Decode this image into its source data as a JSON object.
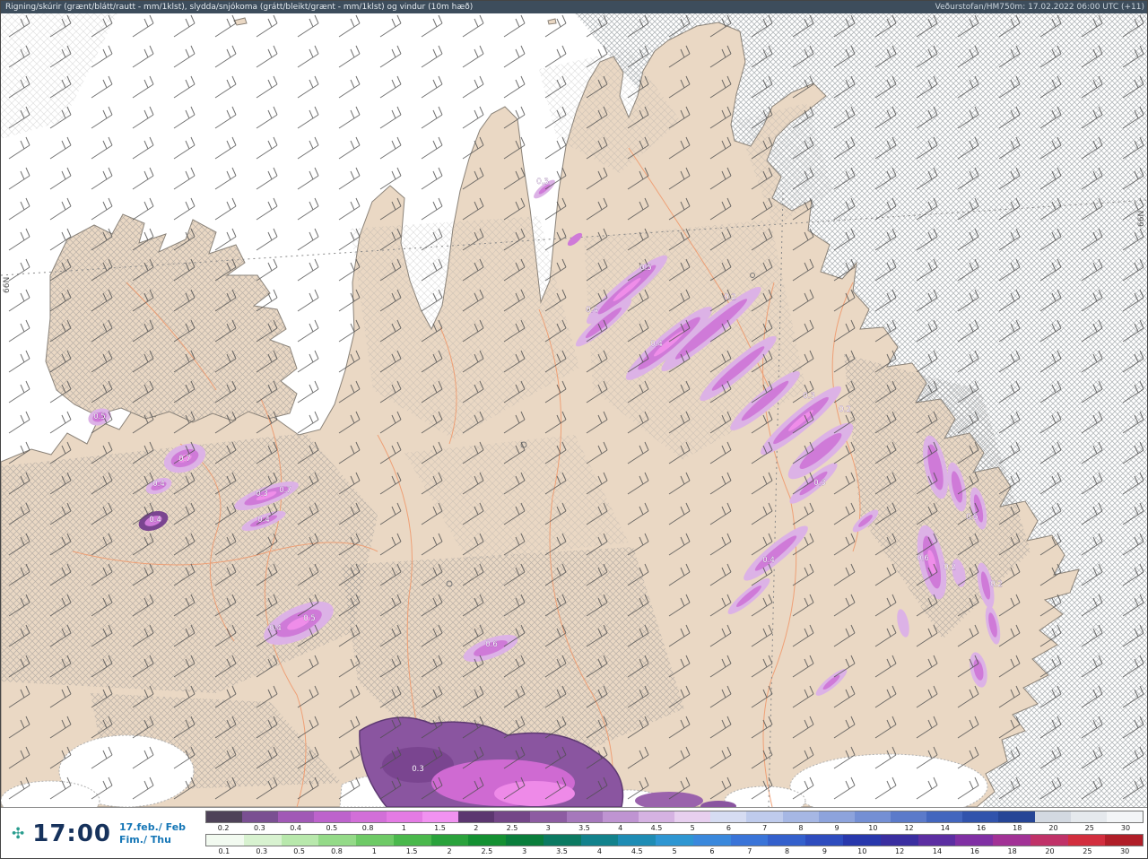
{
  "header": {
    "left": "Rigning/skúrir (grænt/blátt/rautt - mm/1klst), slydda/snjókoma (grátt/bleikt/grænt - mm/1klst) og vindur (10m hæð)",
    "right": "Veðurstofan/HM750m: 17.02.2022 06:00 UTC (+11)"
  },
  "footer": {
    "time": "17:00",
    "date_line1": "17.feb./ Feb",
    "date_line2": "Fim./ Thu",
    "compass_icon": "✣"
  },
  "legend": {
    "snow_scale": {
      "values": [
        "0.2",
        "0.3",
        "0.4",
        "0.5",
        "0.8",
        "1",
        "1.5",
        "2",
        "2.5",
        "3",
        "3.5",
        "4",
        "4.5",
        "5",
        "6",
        "7",
        "8",
        "9",
        "10",
        "12",
        "14",
        "16",
        "18",
        "20",
        "25",
        "30"
      ],
      "colors": [
        "#4e4258",
        "#7a4f92",
        "#a159b6",
        "#bd63cc",
        "#d26fd8",
        "#e47be4",
        "#f192f1",
        "#5c3670",
        "#744688",
        "#8d5ca2",
        "#a678bc",
        "#bf94d2",
        "#d5b2e2",
        "#e7cfef",
        "#d6dcf2",
        "#bfcbec",
        "#a6b7e4",
        "#8da3dc",
        "#748fd4",
        "#5b7aca",
        "#4366be",
        "#3153ac",
        "#264596",
        "#d3d9e1",
        "#e5e9ed",
        "#f3f5f7"
      ]
    },
    "rain_scale": {
      "values": [
        "0.1",
        "0.3",
        "0.5",
        "0.8",
        "1",
        "1.5",
        "2",
        "2.5",
        "3",
        "3.5",
        "4",
        "4.5",
        "5",
        "6",
        "7",
        "8",
        "9",
        "10",
        "12",
        "14",
        "16",
        "18",
        "20",
        "25",
        "30"
      ],
      "colors": [
        "#f2faf0",
        "#d8f2d0",
        "#b8e8ac",
        "#94da88",
        "#6eca66",
        "#4ab84c",
        "#2aa23c",
        "#149032",
        "#0a7e3c",
        "#0c7a62",
        "#12828c",
        "#1e8cb4",
        "#2e96d2",
        "#3a88dc",
        "#3a74d8",
        "#3460cc",
        "#2e4cbe",
        "#2838ac",
        "#3a2ea0",
        "#5c2ea2",
        "#8030a4",
        "#a23296",
        "#c03268",
        "#d22e3e",
        "#b01e28"
      ]
    }
  },
  "map": {
    "lat_label": "66N",
    "land_color": "#ead8c4",
    "precip_labels": [
      {
        "text": "0.3"
      },
      {
        "text": "0.5"
      },
      {
        "text": "0.4"
      },
      {
        "text": "0.2"
      },
      {
        "text": "0.4"
      },
      {
        "text": "0.3"
      },
      {
        "text": "0.2"
      },
      {
        "text": "0.3"
      },
      {
        "text": "0.4"
      },
      {
        "text": "0.5"
      },
      {
        "text": "0.7"
      },
      {
        "text": "0.4"
      },
      {
        "text": "0.3"
      },
      {
        "text": "0.7"
      },
      {
        "text": "0.4"
      },
      {
        "text": "0.4"
      },
      {
        "text": "0.4"
      },
      {
        "text": "0.5"
      },
      {
        "text": "0.6"
      },
      {
        "text": "0.3"
      },
      {
        "text": "0.6"
      },
      {
        "text": "0.2"
      },
      {
        "text": "0.5"
      },
      {
        "text": "0.2"
      }
    ]
  }
}
